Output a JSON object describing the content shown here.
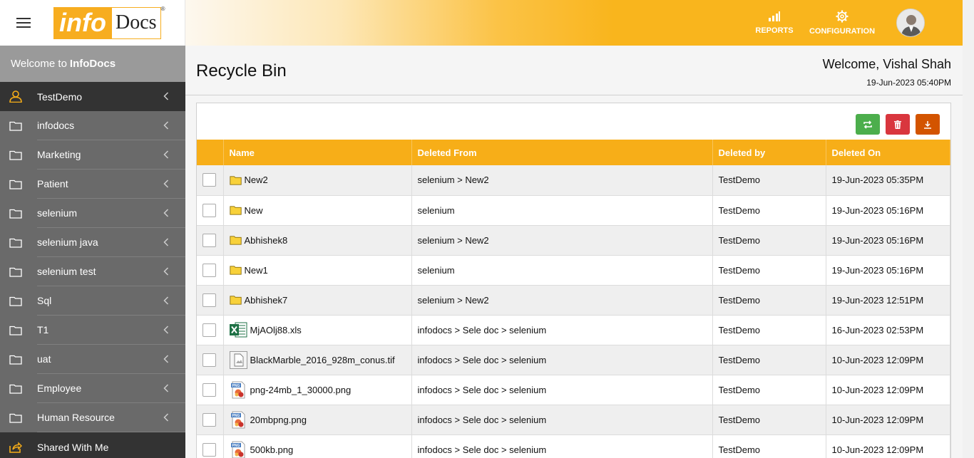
{
  "header": {
    "logo_info": "info",
    "logo_docs": "Docs",
    "logo_reg": "®",
    "reports_label": "REPORTS",
    "configuration_label": "CONFIGURATION"
  },
  "sidebar": {
    "welcome_prefix": "Welcome to",
    "welcome_brand": "InfoDocs",
    "items": [
      {
        "label": "TestDemo",
        "icon": "user-icon"
      },
      {
        "label": "infodocs",
        "icon": "folder-icon"
      },
      {
        "label": "Marketing",
        "icon": "folder-icon"
      },
      {
        "label": "Patient",
        "icon": "folder-icon"
      },
      {
        "label": "selenium",
        "icon": "folder-icon"
      },
      {
        "label": "selenium java",
        "icon": "folder-icon"
      },
      {
        "label": "selenium test",
        "icon": "folder-icon"
      },
      {
        "label": "Sql",
        "icon": "folder-icon"
      },
      {
        "label": "T1",
        "icon": "folder-icon"
      },
      {
        "label": "uat",
        "icon": "folder-icon"
      },
      {
        "label": "Employee",
        "icon": "folder-icon"
      },
      {
        "label": "Human Resource",
        "icon": "folder-icon"
      },
      {
        "label": "Shared With Me",
        "icon": "share-icon"
      }
    ]
  },
  "page": {
    "title": "Recycle Bin",
    "welcome": "Welcome, Vishal Shah",
    "datetime": "19-Jun-2023 05:40PM"
  },
  "table": {
    "headers": [
      "",
      "Name",
      "Deleted From",
      "Deleted by",
      "Deleted On"
    ],
    "rows": [
      {
        "type": "folder",
        "name": "New2",
        "from": "selenium > New2",
        "by": "TestDemo",
        "on": "19-Jun-2023 05:35PM"
      },
      {
        "type": "folder",
        "name": "New",
        "from": "selenium",
        "by": "TestDemo",
        "on": "19-Jun-2023 05:16PM"
      },
      {
        "type": "folder",
        "name": "Abhishek8",
        "from": "selenium > New2",
        "by": "TestDemo",
        "on": "19-Jun-2023 05:16PM"
      },
      {
        "type": "folder",
        "name": "New1",
        "from": "selenium",
        "by": "TestDemo",
        "on": "19-Jun-2023 05:16PM"
      },
      {
        "type": "folder",
        "name": "Abhishek7",
        "from": "selenium > New2",
        "by": "TestDemo",
        "on": "19-Jun-2023 12:51PM"
      },
      {
        "type": "xls",
        "name": "MjAOlj88.xls",
        "from": "infodocs > Sele doc > selenium",
        "by": "TestDemo",
        "on": "16-Jun-2023 02:53PM"
      },
      {
        "type": "tif",
        "name": "BlackMarble_2016_928m_conus.tif",
        "from": "infodocs > Sele doc > selenium",
        "by": "TestDemo",
        "on": "10-Jun-2023 12:09PM"
      },
      {
        "type": "png",
        "name": "png-24mb_1_30000.png",
        "from": "infodocs > Sele doc > selenium",
        "by": "TestDemo",
        "on": "10-Jun-2023 12:09PM"
      },
      {
        "type": "png",
        "name": "20mbpng.png",
        "from": "infodocs > Sele doc > selenium",
        "by": "TestDemo",
        "on": "10-Jun-2023 12:09PM"
      },
      {
        "type": "png",
        "name": "500kb.png",
        "from": "infodocs > Sele doc > selenium",
        "by": "TestDemo",
        "on": "10-Jun-2023 12:09PM"
      }
    ]
  },
  "colors": {
    "accent": "#f7ae18",
    "restore": "#4cae4c",
    "delete": "#d9363e",
    "download": "#d35400"
  }
}
